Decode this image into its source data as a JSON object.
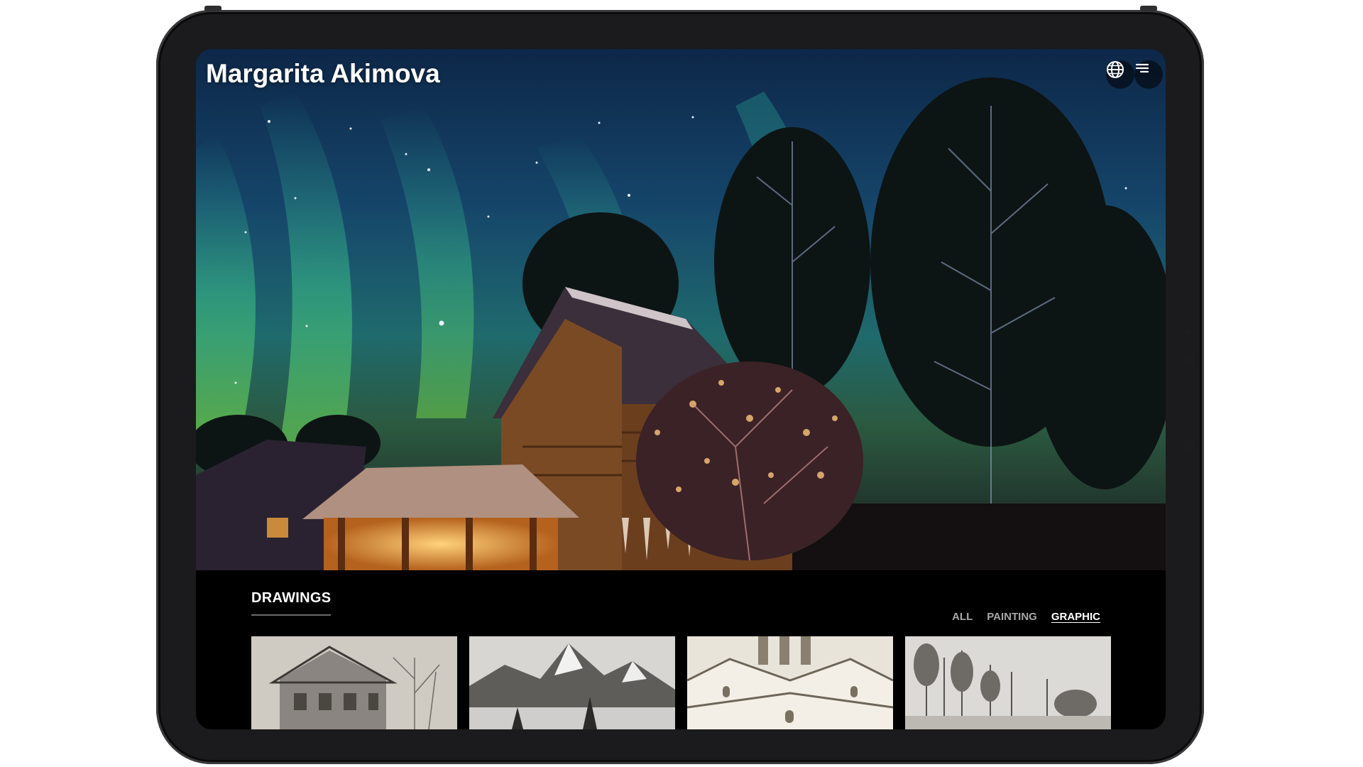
{
  "site": {
    "title": "Margarita Akimova"
  },
  "header": {
    "icons": [
      "globe-icon",
      "menu-icon"
    ]
  },
  "gallery": {
    "section_title": "DRAWINGS",
    "filters": [
      {
        "label": "ALL",
        "active": false
      },
      {
        "label": "PAINTING",
        "active": false
      },
      {
        "label": "GRAPHIC",
        "active": true
      }
    ],
    "thumbnails": [
      "wooden-house-drawing",
      "mountain-drawing",
      "church-drawing",
      "forest-drawing"
    ]
  },
  "colors": {
    "background": "#000000",
    "accent_text": "#ffffff",
    "inactive_filter": "#a8a8a8"
  }
}
